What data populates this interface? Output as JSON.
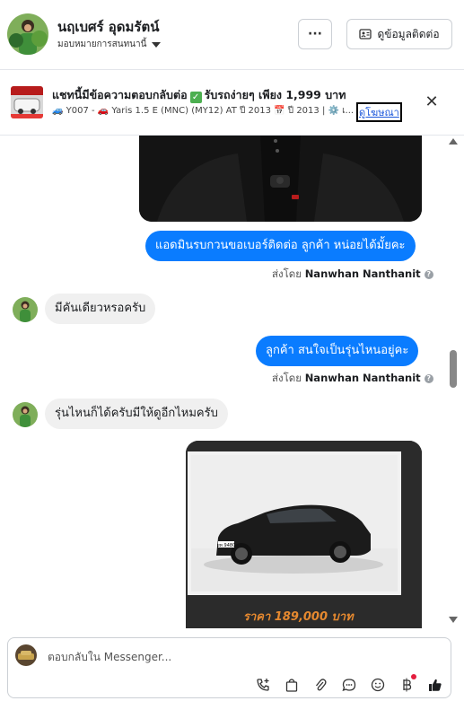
{
  "header": {
    "contact_name": "นฤเบศร์ อุดมรัตน์",
    "assigned_label": "มอบหมายการสนทนานี้",
    "more_label": "···",
    "info_button_label": "ดูข้อมูลติดต่อ"
  },
  "ad_banner": {
    "title_part1": "แชทนี้มีข้อความตอบกลับต่อ",
    "title_part2": "รับรถง่ายๆ เพียง 1,999 บาท",
    "details": "🚙 Y007 - 🚗 Yaris 1.5 E (MNC) (MY12) AT ปี 2013 📅 ปี 2013 | ⚙️ เ...",
    "link_label": "ดูโฆษณา",
    "close_label": "✕"
  },
  "messages": [
    {
      "direction": "out",
      "text": "แอดมินรบกวนขอเบอร์ติดต่อ ลูกค้า หน่อยได้มั้ยคะ"
    },
    {
      "sent_by_prefix": "ส่งโดย",
      "sent_by_name": "Nanwhan Nanthanit"
    },
    {
      "direction": "in",
      "text": "มีคันเดียวหรอครับ"
    },
    {
      "direction": "out",
      "text": "ลูกค้า สนใจเป็นรุ่นไหนอยู่คะ"
    },
    {
      "sent_by_prefix": "ส่งโดย",
      "sent_by_name": "Nanwhan Nanthanit"
    },
    {
      "direction": "in",
      "text": "รุ่นไหนก็ได้ครับมีให้ดูอีกไหมครับ"
    }
  ],
  "image_card": {
    "price_text": "ราคา 189,000 บาท",
    "plate_text": "ยท 9480"
  },
  "composer": {
    "placeholder": "ตอบกลับใน Messenger..."
  },
  "colors": {
    "accent": "#0a7cff",
    "incoming_bubble": "#f0f0f0",
    "price": "#e6892f"
  },
  "icons": [
    "more-icon",
    "contact-card-icon",
    "caret-down-icon",
    "close-icon",
    "call-add-icon",
    "shopping-bag-icon",
    "attach-icon",
    "saved-reply-icon",
    "emoji-icon",
    "payment-icon",
    "like-icon"
  ]
}
